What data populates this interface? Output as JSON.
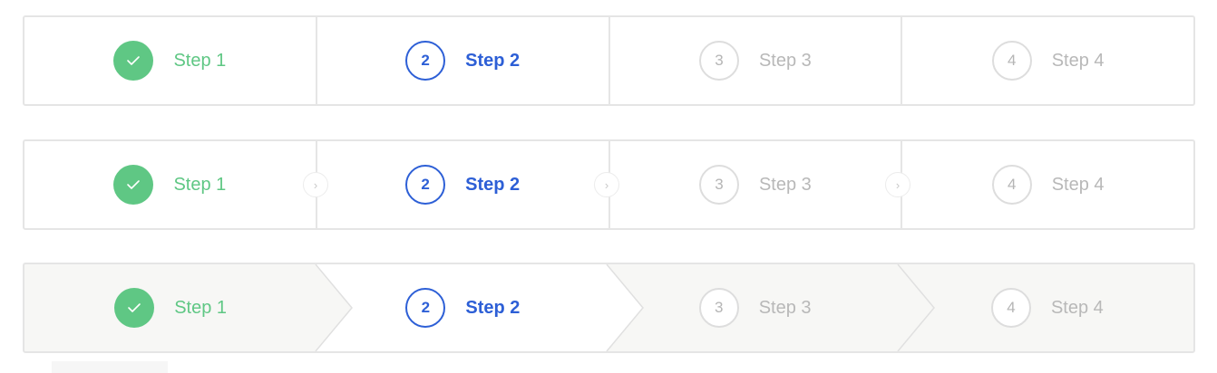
{
  "steppers": [
    {
      "variant": "bordered",
      "steps": [
        {
          "number": "",
          "label": "Step 1",
          "status": "done",
          "icon": "check-icon"
        },
        {
          "number": "2",
          "label": "Step 2",
          "status": "active"
        },
        {
          "number": "3",
          "label": "Step 3",
          "status": "pending"
        },
        {
          "number": "4",
          "label": "Step 4",
          "status": "pending"
        }
      ]
    },
    {
      "variant": "bordered-with-arrows",
      "separator_icon": "chevron-right-icon",
      "steps": [
        {
          "number": "",
          "label": "Step 1",
          "status": "done",
          "icon": "check-icon"
        },
        {
          "number": "2",
          "label": "Step 2",
          "status": "active"
        },
        {
          "number": "3",
          "label": "Step 3",
          "status": "pending"
        },
        {
          "number": "4",
          "label": "Step 4",
          "status": "pending"
        }
      ]
    },
    {
      "variant": "chevron",
      "steps": [
        {
          "number": "",
          "label": "Step 1",
          "status": "done",
          "icon": "check-icon"
        },
        {
          "number": "2",
          "label": "Step 2",
          "status": "active"
        },
        {
          "number": "3",
          "label": "Step 3",
          "status": "pending"
        },
        {
          "number": "4",
          "label": "Step 4",
          "status": "pending"
        }
      ]
    }
  ],
  "colors": {
    "done": "#5fc784",
    "active": "#2d5fd6",
    "pending": "#b8b8b8",
    "border": "#e5e5e5",
    "chevron_inactive_bg": "#f7f7f5",
    "chevron_active_bg": "#ffffff"
  }
}
